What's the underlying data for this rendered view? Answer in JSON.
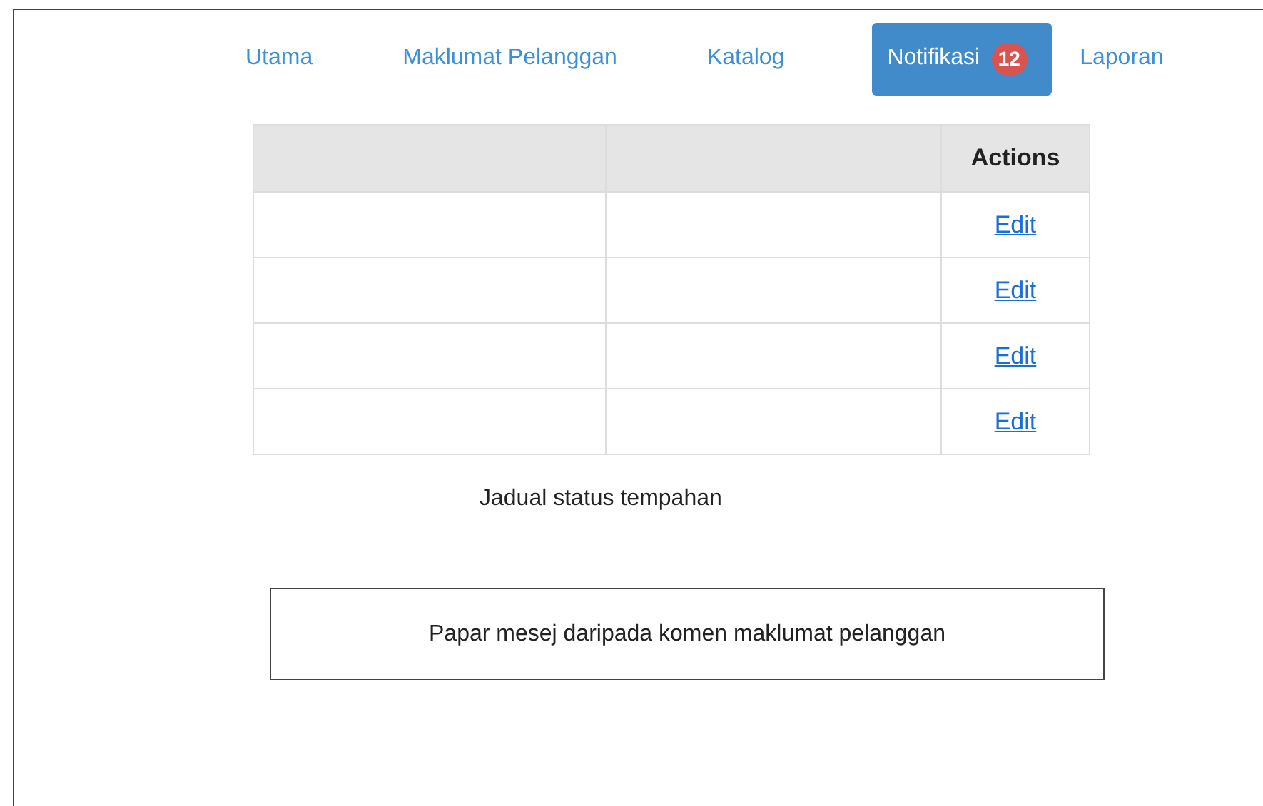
{
  "nav": [
    {
      "label": "Utama",
      "selected": false
    },
    {
      "label": "Maklumat Pelanggan",
      "selected": false
    },
    {
      "label": "Katalog",
      "selected": false
    },
    {
      "label": "Notifikasi",
      "selected": true,
      "badge": "12"
    },
    {
      "label": "Laporan",
      "selected": false
    }
  ],
  "table": {
    "column_3": "Actions",
    "rows": [
      {
        "action": "Edit"
      },
      {
        "action": "Edit"
      },
      {
        "action": "Edit"
      },
      {
        "action": "Edit"
      }
    ],
    "caption": "Jadual status tempahan"
  },
  "message_box": {
    "text": "Papar mesej daripada komen maklumat pelanggan"
  }
}
